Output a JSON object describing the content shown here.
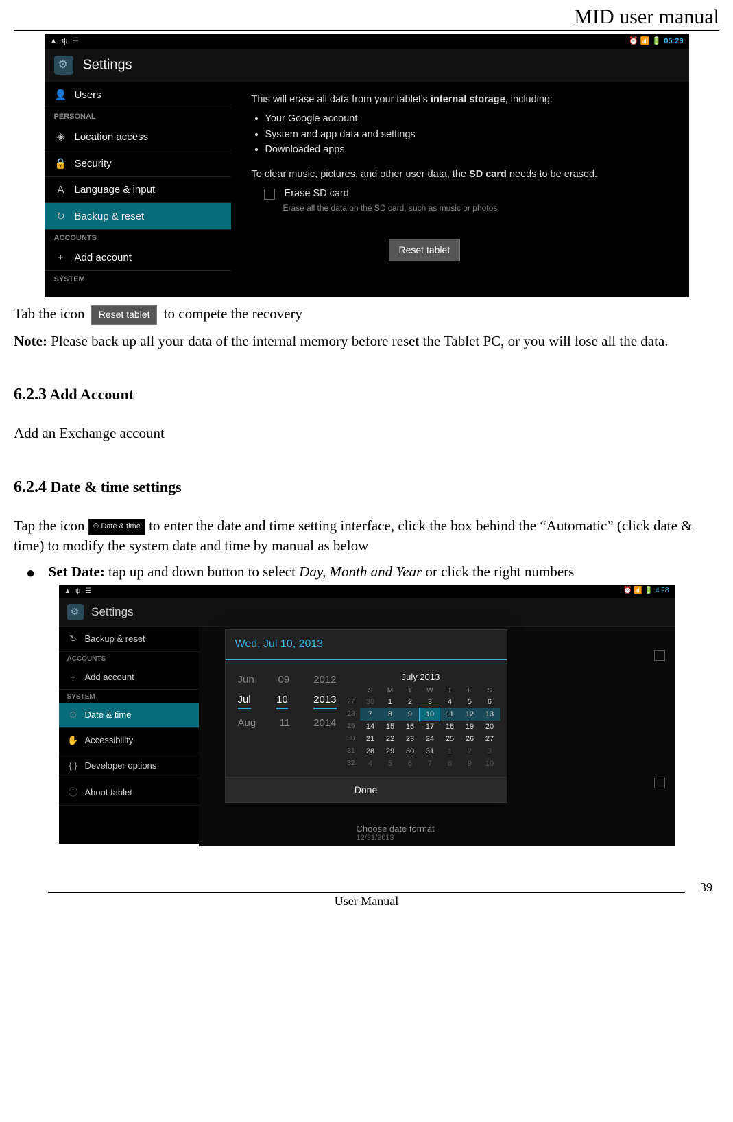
{
  "header": {
    "title": "MID user manual"
  },
  "footer": {
    "text": "User Manual",
    "page_number": "39"
  },
  "ss1": {
    "statusbar": {
      "left_icons": "▲ ψ ☰",
      "right_icons": "⏰ 📶 🔋",
      "time": "05:29"
    },
    "title": "Settings",
    "sidebar": {
      "items_top": [
        {
          "icon": "👤",
          "label": "Users"
        }
      ],
      "header1": "PERSONAL",
      "items_personal": [
        {
          "icon": "◈",
          "label": "Location access"
        },
        {
          "icon": "🔒",
          "label": "Security"
        },
        {
          "icon": "A",
          "label": "Language & input"
        },
        {
          "icon": "↻",
          "label": "Backup & reset",
          "selected": true
        }
      ],
      "header2": "ACCOUNTS",
      "items_accounts": [
        {
          "icon": "+",
          "label": "Add account"
        }
      ],
      "header3": "SYSTEM"
    },
    "content": {
      "line1_a": "This will erase all data from your tablet's ",
      "line1_b": "internal storage",
      "line1_c": ", including:",
      "bullets": [
        "Your Google account",
        "System and app data and settings",
        "Downloaded apps"
      ],
      "line2_a": "To clear music, pictures, and other user data, the ",
      "line2_b": "SD card",
      "line2_c": " needs to be erased.",
      "erase_title": "Erase SD card",
      "erase_sub": "Erase all the data on the SD card, such as music or photos",
      "reset_button": "Reset tablet"
    }
  },
  "body1": {
    "pre": "Tab the icon ",
    "chip": "Reset tablet",
    "post": " to compete the recovery",
    "note_label": "Note:",
    "note_text": " Please back up all your data of the internal memory before reset the Tablet PC, or you will lose all the data."
  },
  "s623": {
    "num": "6.2.3",
    "title": " Add Account",
    "text": "Add an Exchange account"
  },
  "s624": {
    "num": "6.2.4",
    "title": " Date & time settings",
    "p1_pre": "Tap the icon ",
    "chip_icon": "⏱",
    "chip_text": "Date & time",
    "p1_post": " to enter the date and time setting interface, click the box behind the “Automatic” (click date & time) to modify the system date and time by manual as below",
    "bullet_label": "Set Date:",
    "bullet_text_a": " tap up and down button to select ",
    "bullet_ital": "Day, Month and Year",
    "bullet_text_b": " or click the right numbers"
  },
  "ss2": {
    "statusbar": {
      "left_icons": "▲ ψ ☰",
      "right_icons": "⏰ 📶 🔋",
      "time": "4:28"
    },
    "title": "Settings",
    "sidebar": {
      "items": [
        {
          "icon": "↻",
          "label": "Backup & reset"
        }
      ],
      "header1": "ACCOUNTS",
      "items2": [
        {
          "icon": "+",
          "label": "Add account"
        }
      ],
      "header2": "SYSTEM",
      "items3": [
        {
          "icon": "⏱",
          "label": "Date & time",
          "selected": true
        },
        {
          "icon": "✋",
          "label": "Accessibility"
        },
        {
          "icon": "{ }",
          "label": "Developer options"
        },
        {
          "icon": "ⓘ",
          "label": "About tablet"
        }
      ]
    },
    "dialog": {
      "title": "Wed, Jul 10, 2013",
      "spinner": {
        "prev": [
          "Jun",
          "09",
          "2012"
        ],
        "cur": [
          "Jul",
          "10",
          "2013"
        ],
        "next": [
          "Aug",
          "11",
          "2014"
        ]
      },
      "month_label": "July 2013",
      "dow": [
        "S",
        "M",
        "T",
        "W",
        "T",
        "F",
        "S"
      ],
      "weeks": [
        {
          "wk": "27",
          "d": [
            "30",
            "1",
            "2",
            "3",
            "4",
            "5",
            "6"
          ],
          "off": [
            0
          ]
        },
        {
          "wk": "28",
          "d": [
            "7",
            "8",
            "9",
            "10",
            "11",
            "12",
            "13"
          ],
          "hl": true,
          "today": 3
        },
        {
          "wk": "29",
          "d": [
            "14",
            "15",
            "16",
            "17",
            "18",
            "19",
            "20"
          ]
        },
        {
          "wk": "30",
          "d": [
            "21",
            "22",
            "23",
            "24",
            "25",
            "26",
            "27"
          ]
        },
        {
          "wk": "31",
          "d": [
            "28",
            "29",
            "30",
            "31",
            "1",
            "2",
            "3"
          ],
          "off": [
            4,
            5,
            6
          ]
        },
        {
          "wk": "32",
          "d": [
            "4",
            "5",
            "6",
            "7",
            "8",
            "9",
            "10"
          ],
          "off": [
            0,
            1,
            2,
            3,
            4,
            5,
            6
          ]
        }
      ],
      "done": "Done"
    },
    "choose": {
      "title": "Choose date format",
      "sub": "12/31/2013"
    }
  }
}
